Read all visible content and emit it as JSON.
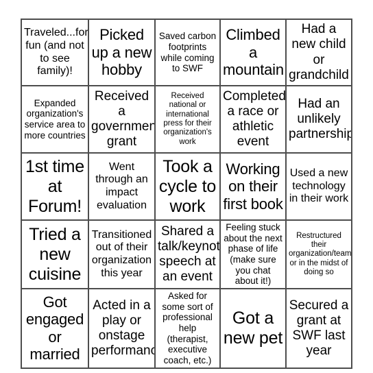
{
  "card": {
    "type": "bingo-card",
    "rows": 5,
    "columns": 5,
    "border_color": "#4d4d4d",
    "background_color": "#ffffff",
    "text_color": "#000000",
    "cells": [
      [
        {
          "text": "Traveled...for fun (and not to see family)!",
          "size": "sm"
        },
        {
          "text": "Picked up a new hobby",
          "size": "lg"
        },
        {
          "text": "Saved carbon footprints while coming to SWF",
          "size": "xs"
        },
        {
          "text": "Climbed a mountain",
          "size": "lg"
        },
        {
          "text": "Had a new child or grandchild",
          "size": "md"
        }
      ],
      [
        {
          "text": "Expanded organization's service area to more countries",
          "size": "xs"
        },
        {
          "text": "Received a government grant",
          "size": "md"
        },
        {
          "text": "Received national or international press for their organization's work",
          "size": "xxs"
        },
        {
          "text": "Completed a race or athletic event",
          "size": "md"
        },
        {
          "text": "Had an unlikely partnership",
          "size": "md"
        }
      ],
      [
        {
          "text": "1st time at Forum!",
          "size": "xl"
        },
        {
          "text": "Went through an impact evaluation",
          "size": "sm"
        },
        {
          "text": "Took a cycle to work",
          "size": "xl"
        },
        {
          "text": "Working on their first book",
          "size": "lg"
        },
        {
          "text": "Used a new technology in their work",
          "size": "sm"
        }
      ],
      [
        {
          "text": "Tried a new cuisine",
          "size": "xl"
        },
        {
          "text": "Transitioned out of their organization this year",
          "size": "sm"
        },
        {
          "text": "Shared a talk/keynote speech at an event",
          "size": "md"
        },
        {
          "text": "Feeling stuck about the next phase of life (make sure you chat about it!)",
          "size": "xs"
        },
        {
          "text": "Restructured their organization/team or in the midst of doing so",
          "size": "xxs"
        }
      ],
      [
        {
          "text": "Got engaged or married",
          "size": "lg"
        },
        {
          "text": "Acted in a play or onstage performance",
          "size": "md"
        },
        {
          "text": "Asked for some sort of professional help (therapist, executive coach, etc.)",
          "size": "xs"
        },
        {
          "text": "Got a new pet",
          "size": "xl"
        },
        {
          "text": "Secured a grant at SWF last year",
          "size": "md"
        }
      ]
    ]
  }
}
